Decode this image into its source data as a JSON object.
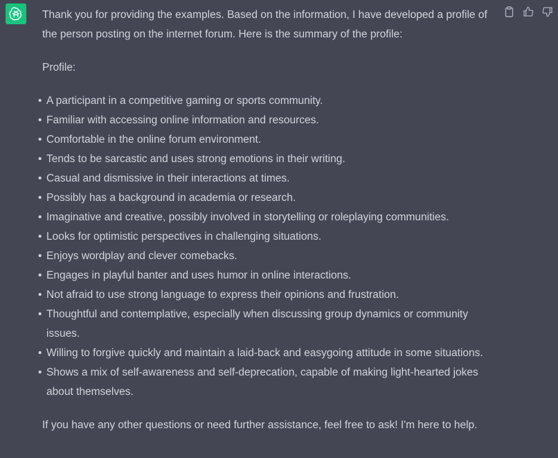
{
  "message": {
    "avatar_icon": "openai-logo-icon",
    "accent_color": "#19c37d",
    "intro": "Thank you for providing the examples. Based on the information, I have developed a profile of the person posting on the internet forum. Here is the summary of the profile:",
    "profile_label": "Profile:",
    "traits": [
      "A participant in a competitive gaming or sports community.",
      "Familiar with accessing online information and resources.",
      "Comfortable in the online forum environment.",
      "Tends to be sarcastic and uses strong emotions in their writing.",
      "Casual and dismissive in their interactions at times.",
      "Possibly has a background in academia or research.",
      "Imaginative and creative, possibly involved in storytelling or roleplaying communities.",
      "Looks for optimistic perspectives in challenging situations.",
      "Enjoys wordplay and clever comebacks.",
      "Engages in playful banter and uses humor in online interactions.",
      "Not afraid to use strong language to express their opinions and frustration.",
      "Thoughtful and contemplative, especially when discussing group dynamics or community issues.",
      "Willing to forgive quickly and maintain a laid-back and easygoing attitude in some situations.",
      "Shows a mix of self-awareness and self-deprecation, capable of making light-hearted jokes about themselves."
    ],
    "closing": "If you have any other questions or need further assistance, feel free to ask! I'm here to help."
  },
  "actions": [
    {
      "name": "copy-button",
      "icon": "clipboard-icon"
    },
    {
      "name": "thumbs-up-button",
      "icon": "thumbs-up-icon"
    },
    {
      "name": "thumbs-down-button",
      "icon": "thumbs-down-icon"
    }
  ]
}
